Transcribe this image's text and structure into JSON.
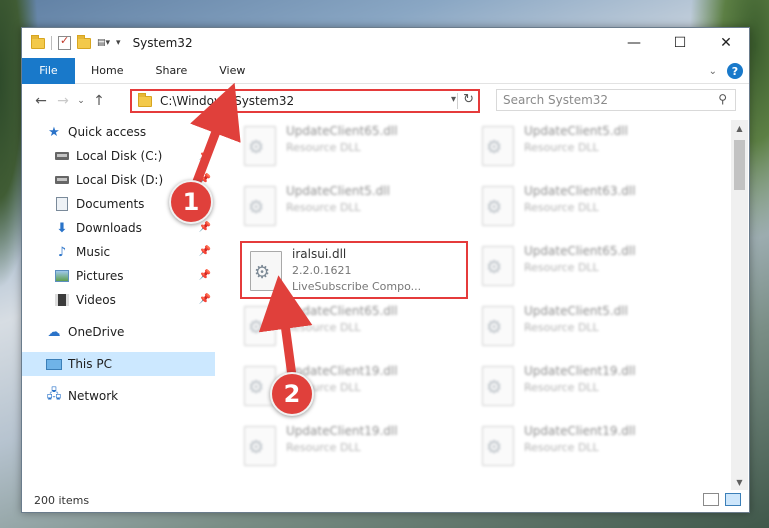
{
  "window": {
    "title": "System32",
    "caption": {
      "minimize": "—",
      "maximize": "☐",
      "close": "✕"
    }
  },
  "ribbon": {
    "tabs": [
      "File",
      "Home",
      "Share",
      "View"
    ],
    "help": "?"
  },
  "nav": {
    "back": "←",
    "forward": "→",
    "recent": "⌄",
    "up": "↑",
    "address": "C:\\Windows\\System32",
    "search_placeholder": "Search System32"
  },
  "sidebar": {
    "items": [
      {
        "label": "Quick access",
        "icon": "star-icon"
      },
      {
        "label": "Local Disk (C:)",
        "icon": "drive-icon"
      },
      {
        "label": "Local Disk (D:)",
        "icon": "drive-icon"
      },
      {
        "label": "Documents",
        "icon": "documents-icon"
      },
      {
        "label": "Downloads",
        "icon": "downloads-icon"
      },
      {
        "label": "Music",
        "icon": "music-icon"
      },
      {
        "label": "Pictures",
        "icon": "pictures-icon"
      },
      {
        "label": "Videos",
        "icon": "videos-icon"
      },
      {
        "label": "OneDrive",
        "icon": "cloud-icon"
      },
      {
        "label": "This PC",
        "icon": "computer-icon"
      },
      {
        "label": "Network",
        "icon": "network-icon"
      }
    ]
  },
  "files": {
    "col1": [
      {
        "name": "UpdateClient65.dll",
        "type": "Resource DLL"
      },
      {
        "name": "UpdateClient5.dll",
        "type": "Resource DLL"
      },
      {
        "name": "iralsui.dll",
        "version": "2.2.0.1621",
        "desc": "LiveSubscribe Compo..."
      },
      {
        "name": "UpdateClient65.dll",
        "type": "Resource DLL"
      },
      {
        "name": "UpdateClient19.dll",
        "type": "Resource DLL"
      },
      {
        "name": "UpdateClient19.dll",
        "type": "Resource DLL"
      }
    ],
    "col2": [
      {
        "name": "UpdateClient5.dll",
        "type": "Resource DLL"
      },
      {
        "name": "UpdateClient63.dll",
        "type": "Resource DLL"
      },
      {
        "name": "UpdateClient65.dll",
        "type": "Resource DLL"
      },
      {
        "name": "UpdateClient5.dll",
        "type": "Resource DLL"
      },
      {
        "name": "UpdateClient19.dll",
        "type": "Resource DLL"
      },
      {
        "name": "UpdateClient19.dll",
        "type": "Resource DLL"
      }
    ]
  },
  "status": {
    "count": "200 items"
  },
  "annotations": {
    "step1": "1",
    "step2": "2",
    "color": "#e0403b"
  }
}
